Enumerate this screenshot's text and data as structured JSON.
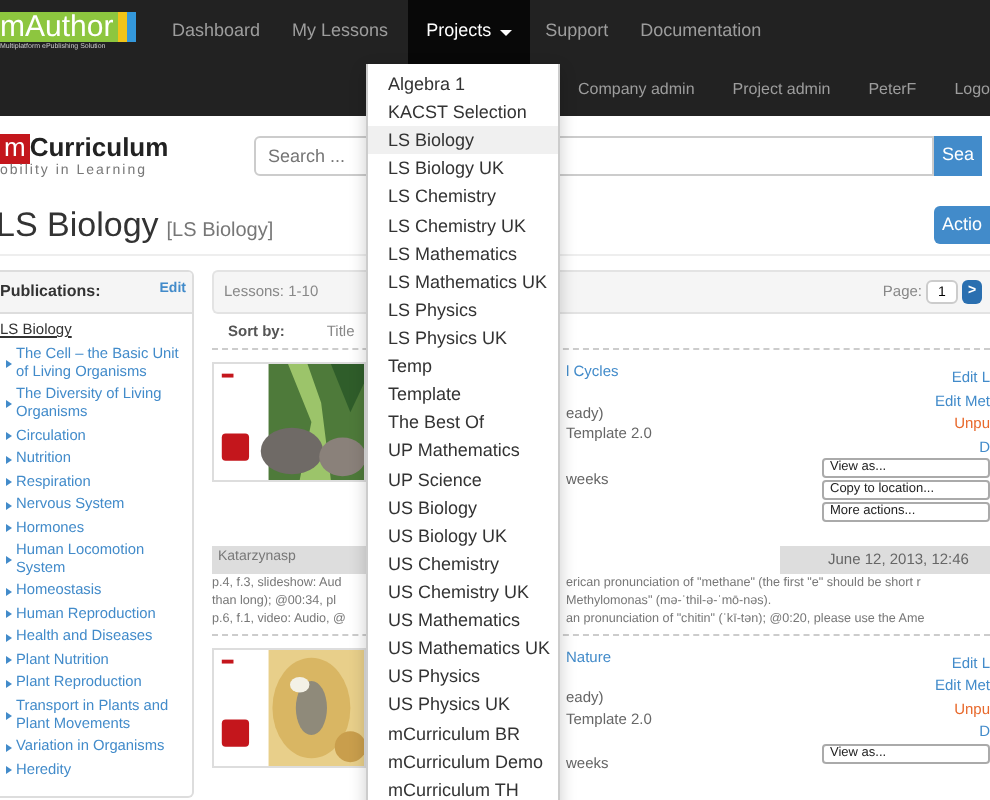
{
  "navbar": {
    "logo": {
      "name": "mAuthor",
      "tagline": "Multiplatform ePublishing Solution"
    },
    "items": [
      {
        "label": "Dashboard",
        "selected": false,
        "dropdown": false
      },
      {
        "label": "My Lessons",
        "selected": false,
        "dropdown": false
      },
      {
        "label": "Projects",
        "selected": true,
        "dropdown": true
      },
      {
        "label": "Support",
        "selected": false,
        "dropdown": false
      },
      {
        "label": "Documentation",
        "selected": false,
        "dropdown": false
      }
    ],
    "secondary": [
      "Company admin",
      "Project admin",
      "PeterF",
      "Logo"
    ]
  },
  "projects_menu": [
    {
      "label": "Algebra 1",
      "selected": false
    },
    {
      "label": "KACST Selection",
      "selected": false
    },
    {
      "label": "LS Biology",
      "selected": true
    },
    {
      "label": "LS Biology UK",
      "selected": false
    },
    {
      "label": "LS Chemistry",
      "selected": false
    },
    {
      "label": "LS Chemistry UK",
      "selected": false
    },
    {
      "label": "LS Mathematics",
      "selected": false
    },
    {
      "label": "LS Mathematics UK",
      "selected": false
    },
    {
      "label": "LS Physics",
      "selected": false
    },
    {
      "label": "LS Physics UK",
      "selected": false
    },
    {
      "label": "Temp",
      "selected": false
    },
    {
      "label": "Template",
      "selected": false
    },
    {
      "label": "The Best Of",
      "selected": false
    },
    {
      "label": "UP Mathematics",
      "selected": false
    },
    {
      "label": "UP Science",
      "selected": false
    },
    {
      "label": "US Biology",
      "selected": false
    },
    {
      "label": "US Biology UK",
      "selected": false
    },
    {
      "label": "US Chemistry",
      "selected": false
    },
    {
      "label": "US Chemistry UK",
      "selected": false
    },
    {
      "label": "US Mathematics",
      "selected": false
    },
    {
      "label": "US Mathematics UK",
      "selected": false
    },
    {
      "label": "US Physics",
      "selected": false
    },
    {
      "label": "US Physics UK",
      "selected": false
    },
    {
      "label": "mCurriculum BR",
      "selected": false
    },
    {
      "label": "mCurriculum Demo",
      "selected": false
    },
    {
      "label": "mCurriculum TH",
      "selected": false
    }
  ],
  "brand": {
    "letter": "m",
    "name": "Curriculum",
    "tagline": "obility in Learning"
  },
  "search": {
    "placeholder": "Search ...",
    "button": "Sea"
  },
  "page_title": "LS Biology",
  "page_subtitle": "[LS Biology]",
  "actions_button": "Actio",
  "sidebar": {
    "heading": "Publications:",
    "edit": "Edit",
    "tree": [
      {
        "label": "LS Biology",
        "children": [
          {
            "label": "The Cell – the Basic Unit of Living Organisms"
          },
          {
            "label": "The Diversity of Living Organisms"
          },
          {
            "label": "Circulation"
          },
          {
            "label": "Nutrition"
          },
          {
            "label": "Respiration"
          },
          {
            "label": "Nervous System"
          },
          {
            "label": "Hormones"
          },
          {
            "label": "Human Locomotion System"
          },
          {
            "label": "Homeostasis"
          },
          {
            "label": "Human Reproduction"
          },
          {
            "label": "Health and Diseases"
          },
          {
            "label": "Plant Nutrition"
          },
          {
            "label": "Plant Reproduction"
          },
          {
            "label": "Transport in Plants and Plant Movements"
          },
          {
            "label": "Variation in Organisms"
          },
          {
            "label": "Heredity"
          }
        ]
      }
    ]
  },
  "lessons": {
    "range": "Lessons: 1-10",
    "page_label": "Page:",
    "page": "1",
    "next": ">",
    "sort_label": "Sort by:",
    "sort_option": "Title",
    "items": [
      {
        "title": "l Cycles",
        "status": "eady)",
        "template": "Template 2.0",
        "age": "weeks",
        "links": [
          {
            "label": "Edit L",
            "kind": "link"
          },
          {
            "label": "Edit Met",
            "kind": "link"
          },
          {
            "label": "Unpu",
            "kind": "warning"
          },
          {
            "label": "D",
            "kind": "link"
          }
        ],
        "selects": [
          "View as...",
          "Copy to location...",
          "More actions..."
        ],
        "comment": {
          "author": "Katarzynasp",
          "date": "June 12, 2013, 12:46",
          "lines": [
            {
              "left": "p.4, f.3, slideshow: Aud",
              "right": "erican pronunciation of \"methane\" (the first \"e\" should be short r"
            },
            {
              "left": "than long); @00:34, pl",
              "right": "Methylomonas\" (mə-ˈthil-ə-ˈmō-nəs)."
            },
            {
              "left": "p.6, f.1, video: Audio, @",
              "right": "an pronunciation of \"chitin\" (ˈkī-tən); @0:20, please use the Ame"
            }
          ]
        }
      },
      {
        "title": "Nature",
        "status": "eady)",
        "template": "Template 2.0",
        "age": "weeks",
        "links": [
          {
            "label": "Edit L",
            "kind": "link"
          },
          {
            "label": "Edit Met",
            "kind": "link"
          },
          {
            "label": "Unpu",
            "kind": "warning"
          },
          {
            "label": "D",
            "kind": "link"
          }
        ],
        "selects": [
          "View as..."
        ]
      }
    ]
  }
}
